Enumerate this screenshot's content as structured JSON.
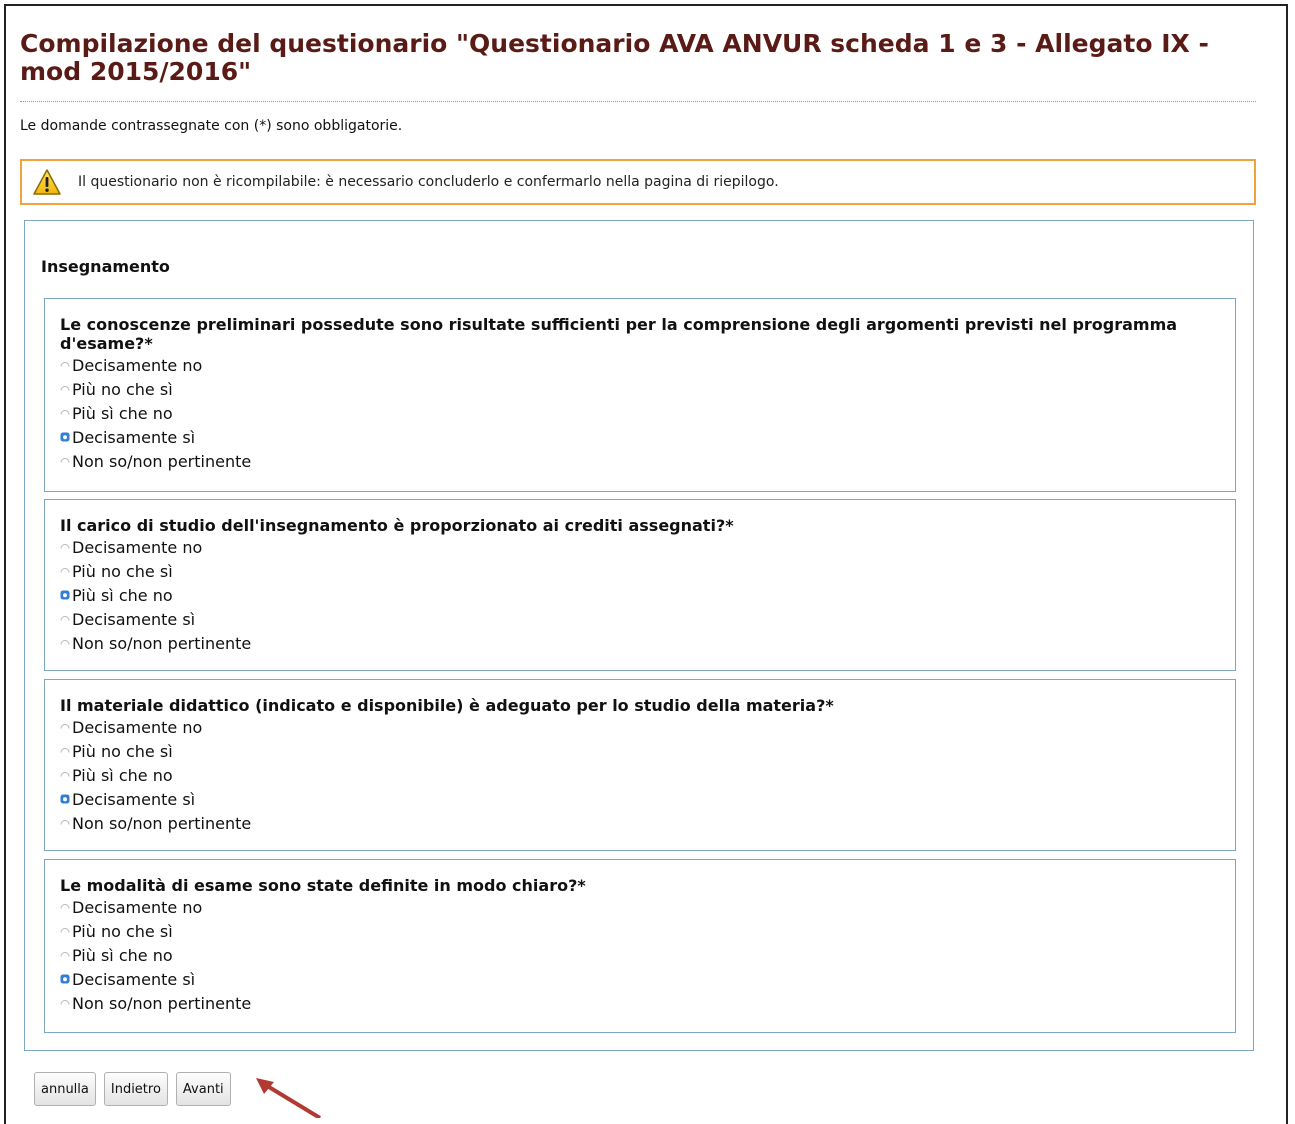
{
  "page": {
    "title": "Compilazione del questionario \"Questionario AVA ANVUR scheda 1 e 3 - Allegato IX - mod 2015/2016\"",
    "required_note": "Le domande contrassegnate con (*) sono obbligatorie.",
    "warning": "Il questionario non è ricompilabile: è necessario concluderlo e confermarlo nella pagina di riepilogo.",
    "warning_icon": "warning-triangle-icon"
  },
  "section": {
    "title": "Insegnamento",
    "questions": [
      {
        "text": "Le conoscenze preliminari possedute sono risultate sufficienti per la comprensione degli argomenti previsti nel programma d'esame?*",
        "options": [
          "Decisamente no",
          "Più no che sì",
          "Più sì che no",
          "Decisamente sì",
          "Non so/non pertinente"
        ],
        "selected": "Decisamente sì"
      },
      {
        "text": "Il carico di studio dell'insegnamento è proporzionato ai crediti assegnati?*",
        "options": [
          "Decisamente no",
          "Più no che sì",
          "Più sì che no",
          "Decisamente sì",
          "Non so/non pertinente"
        ],
        "selected": "Più sì che no"
      },
      {
        "text": "Il materiale didattico (indicato e disponibile) è adeguato per lo studio della materia?*",
        "options": [
          "Decisamente no",
          "Più no che sì",
          "Più sì che no",
          "Decisamente sì",
          "Non so/non pertinente"
        ],
        "selected": "Decisamente sì"
      },
      {
        "text": "Le modalità di esame sono state definite in modo chiaro?*",
        "options": [
          "Decisamente no",
          "Più no che sì",
          "Più sì che no",
          "Decisamente sì",
          "Non so/non pertinente"
        ],
        "selected": "Decisamente sì"
      }
    ]
  },
  "buttons": {
    "cancel": "annulla",
    "back": "Indietro",
    "next": "Avanti"
  },
  "colors": {
    "title": "#5a1a15",
    "box_border": "#7fa7c2",
    "warning_border": "#f0a33d",
    "radio_selected": "#2f7fd6",
    "annotation_arrow": "#b23a33"
  }
}
